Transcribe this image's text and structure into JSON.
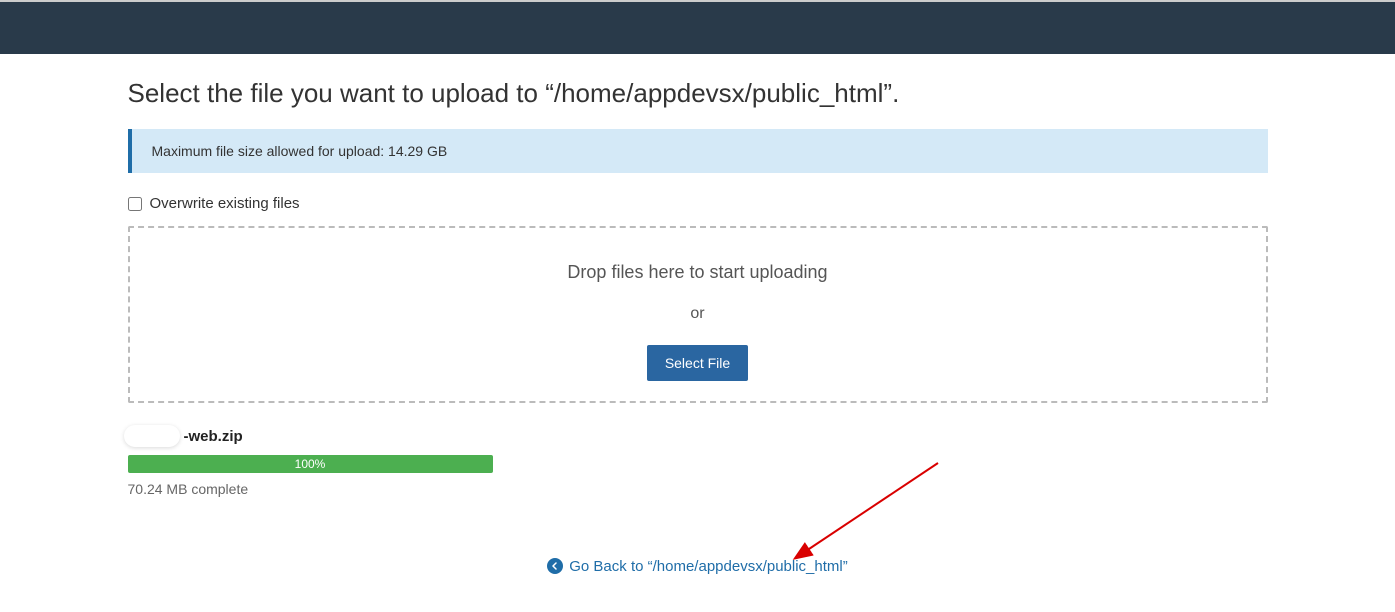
{
  "page": {
    "title_prefix": "Select the file you want to upload to ",
    "upload_path": "“/home/appdevsx/public_html”",
    "title_suffix": "."
  },
  "info": {
    "message": "Maximum file size allowed for upload: 14.29 GB"
  },
  "overwrite": {
    "label": "Overwrite existing files",
    "checked": false
  },
  "dropzone": {
    "drop_text": "Drop files here to start uploading",
    "or_text": "or",
    "select_button": "Select File"
  },
  "upload": {
    "filename": "-web.zip",
    "progress_percent": "100%",
    "status": "70.24 MB complete"
  },
  "back_link": {
    "prefix": "Go Back to ",
    "path": "“/home/appdevsx/public_html”"
  }
}
